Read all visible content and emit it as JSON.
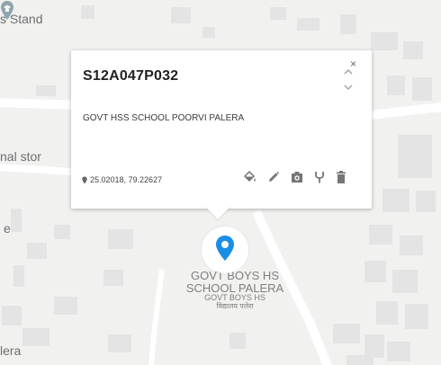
{
  "map": {
    "place_labels": {
      "stand": "s Stand",
      "store": "nal stor",
      "edge": "e",
      "palera": "lera"
    },
    "school": {
      "line1": "GOVT BOYS HS",
      "line2": "SCHOOL PALERA",
      "line3": "GOVT BOYS HS",
      "line4": "विद्यालय पलेरा"
    },
    "marker_color": "#1a8ee6",
    "marker_secondary_color": "#8fa4ad"
  },
  "popup": {
    "title": "S12A047P032",
    "name": "GOVT HSS SCHOOL POORVI PALERA",
    "coordinates": "25.02018, 79.22627",
    "close_glyph": "×",
    "icons": [
      "location-pin-icon",
      "paint-bucket-icon",
      "pencil-icon",
      "camera-icon",
      "tuning-fork-icon",
      "trash-icon"
    ]
  }
}
